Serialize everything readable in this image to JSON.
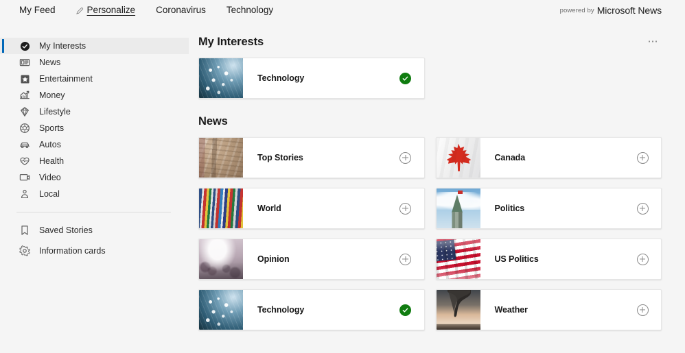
{
  "header": {
    "nav": [
      {
        "label": "My Feed",
        "active": false,
        "icon": null
      },
      {
        "label": "Personalize",
        "active": true,
        "icon": "pencil-icon"
      },
      {
        "label": "Coronavirus",
        "active": false,
        "icon": null
      },
      {
        "label": "Technology",
        "active": false,
        "icon": null
      }
    ],
    "brand_prefix": "powered by",
    "brand_name": "Microsoft News"
  },
  "sidebar": {
    "items": [
      {
        "label": "My Interests",
        "icon": "check-circle-icon",
        "selected": true
      },
      {
        "label": "News",
        "icon": "newspaper-icon",
        "selected": false
      },
      {
        "label": "Entertainment",
        "icon": "star-box-icon",
        "selected": false
      },
      {
        "label": "Money",
        "icon": "chart-up-icon",
        "selected": false
      },
      {
        "label": "Lifestyle",
        "icon": "gem-icon",
        "selected": false
      },
      {
        "label": "Sports",
        "icon": "ball-icon",
        "selected": false
      },
      {
        "label": "Autos",
        "icon": "car-icon",
        "selected": false
      },
      {
        "label": "Health",
        "icon": "heartbeat-icon",
        "selected": false
      },
      {
        "label": "Video",
        "icon": "video-icon",
        "selected": false
      },
      {
        "label": "Local",
        "icon": "person-pin-icon",
        "selected": false
      }
    ],
    "footer_items": [
      {
        "label": "Saved Stories",
        "icon": "bookmark-icon"
      },
      {
        "label": "Information cards",
        "icon": "gear-icon"
      }
    ]
  },
  "main": {
    "overflow_menu_label": "⋯",
    "sections": [
      {
        "title": "My Interests",
        "layout": "single",
        "cards": [
          {
            "label": "Technology",
            "thumb": "t-tech",
            "state": "added",
            "action_icon": "check-circle-filled-icon"
          }
        ]
      },
      {
        "title": "News",
        "layout": "double",
        "cards": [
          {
            "label": "Top Stories",
            "thumb": "t-top",
            "state": "available",
            "action_icon": "plus-circle-icon"
          },
          {
            "label": "Canada",
            "thumb": "t-canada",
            "state": "available",
            "action_icon": "plus-circle-icon"
          },
          {
            "label": "World",
            "thumb": "t-world",
            "state": "available",
            "action_icon": "plus-circle-icon"
          },
          {
            "label": "Politics",
            "thumb": "t-politics",
            "state": "available",
            "action_icon": "plus-circle-icon"
          },
          {
            "label": "Opinion",
            "thumb": "t-opinion",
            "state": "available",
            "action_icon": "plus-circle-icon"
          },
          {
            "label": "US Politics",
            "thumb": "t-usflag",
            "state": "available",
            "action_icon": "plus-circle-icon"
          },
          {
            "label": "Technology",
            "thumb": "t-tech",
            "state": "added",
            "action_icon": "check-circle-filled-icon"
          },
          {
            "label": "Weather",
            "thumb": "t-weather",
            "state": "available",
            "action_icon": "plus-circle-icon"
          }
        ]
      }
    ]
  },
  "colors": {
    "accent": "#0067b8",
    "added_green": "#107c10",
    "page_bg": "#f5f5f5",
    "card_bg": "#ffffff",
    "selected_row": "#ebebeb"
  }
}
